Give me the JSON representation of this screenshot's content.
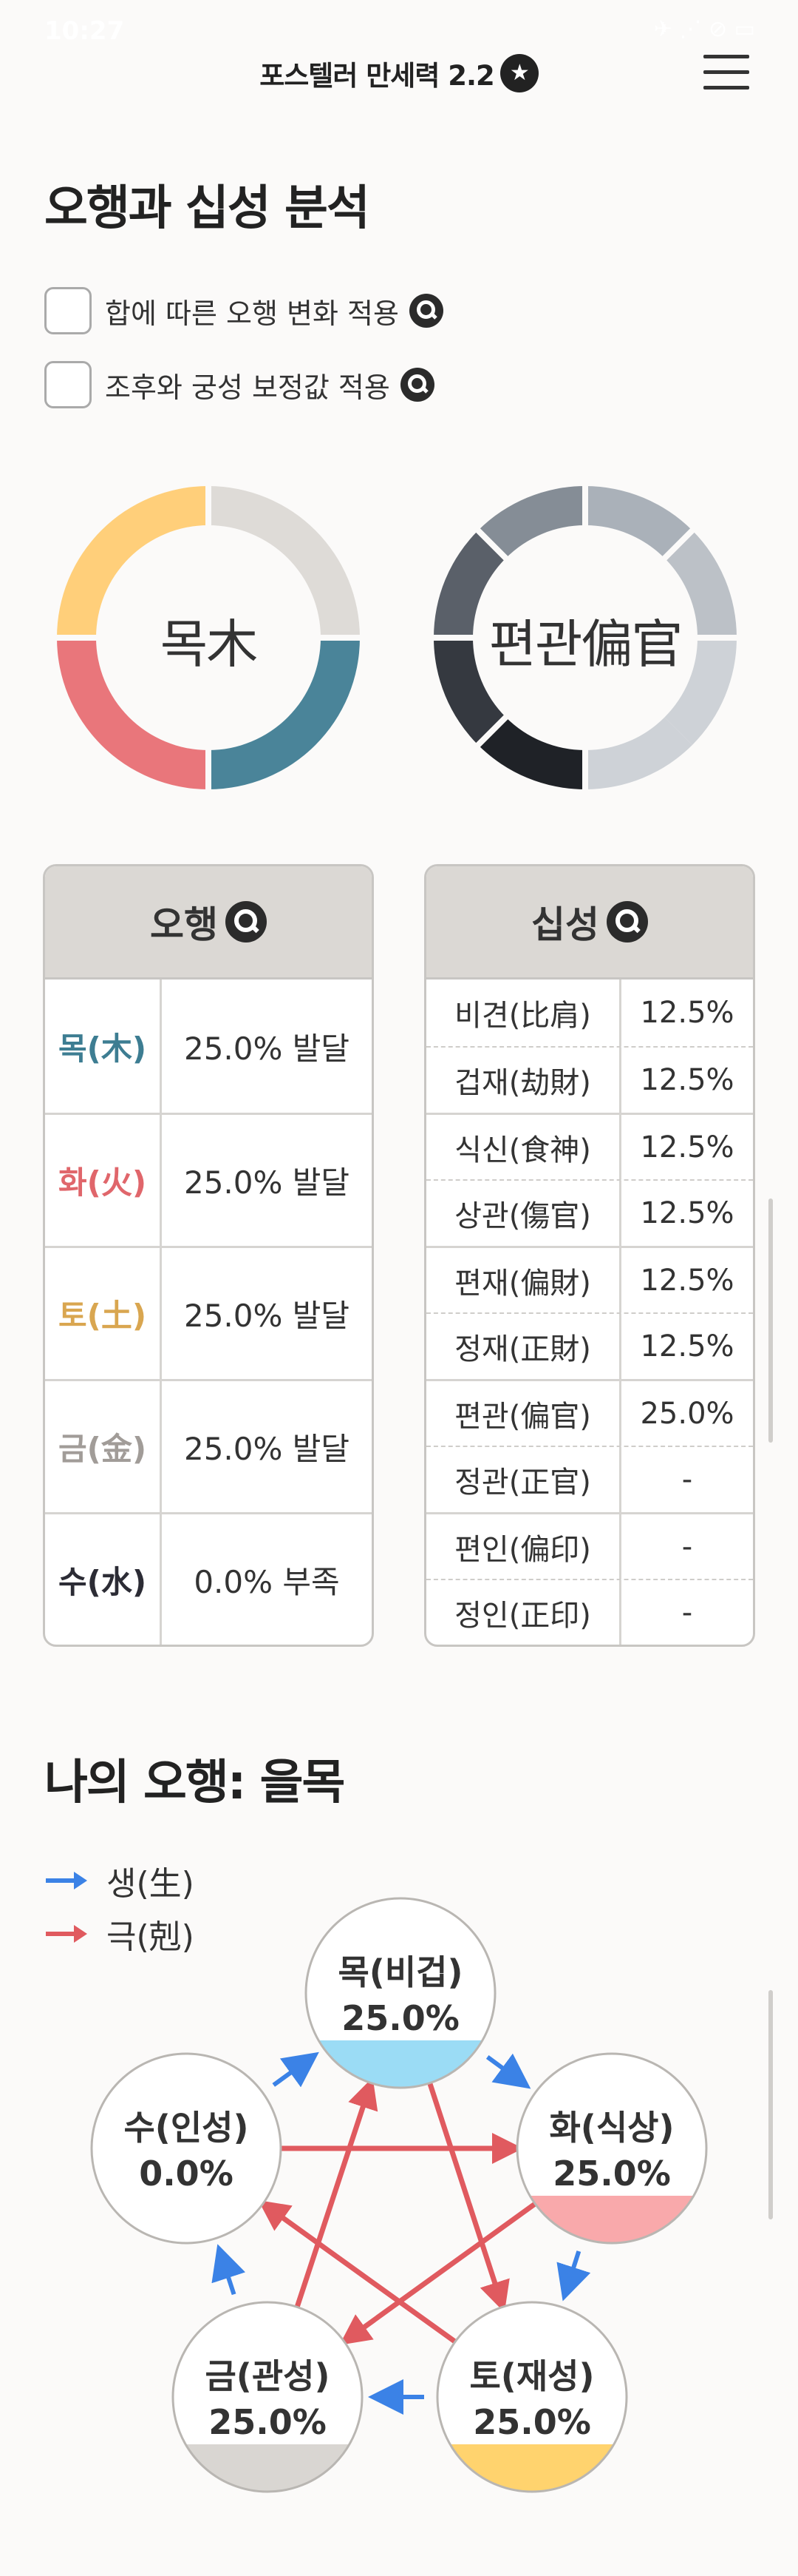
{
  "status": {
    "time": "10:27",
    "icons": "✈ ⋰ ⊘ ▭"
  },
  "header": {
    "title": "포스텔러 만세력 2.2",
    "star": "★"
  },
  "section1": {
    "heading": "오행과 십성 분석",
    "options": [
      {
        "label": "합에 따른 오행 변화 적용",
        "checked": false
      },
      {
        "label": "조후와 궁성 보정값 적용",
        "checked": false
      }
    ]
  },
  "donuts": {
    "ohaeng": {
      "label": "목木"
    },
    "sipseong": {
      "label": "편관偏官"
    }
  },
  "ohaeng_table": {
    "header": "오행",
    "rows": [
      {
        "element": "목(木)",
        "value": "25.0% 발달",
        "color": "#3d7d92"
      },
      {
        "element": "화(火)",
        "value": "25.0% 발달",
        "color": "#e0666b"
      },
      {
        "element": "토(土)",
        "value": "25.0% 발달",
        "color": "#d9a650"
      },
      {
        "element": "금(金)",
        "value": "25.0% 발달",
        "color": "#a19c98"
      },
      {
        "element": "수(水)",
        "value": "0.0% 부족",
        "color": "#2c2c35"
      }
    ]
  },
  "sipseong_table": {
    "header": "십성",
    "rows": [
      {
        "name": "비견(比肩)",
        "value": "12.5%"
      },
      {
        "name": "겁재(劫財)",
        "value": "12.5%"
      },
      {
        "name": "식신(食神)",
        "value": "12.5%"
      },
      {
        "name": "상관(傷官)",
        "value": "12.5%"
      },
      {
        "name": "편재(偏財)",
        "value": "12.5%"
      },
      {
        "name": "정재(正財)",
        "value": "12.5%"
      },
      {
        "name": "편관(偏官)",
        "value": "25.0%"
      },
      {
        "name": "정관(正官)",
        "value": "-"
      },
      {
        "name": "편인(偏印)",
        "value": "-"
      },
      {
        "name": "정인(正印)",
        "value": "-"
      }
    ]
  },
  "section2": {
    "heading": "나의 오행: 을목",
    "legend": [
      {
        "label": "생(生)",
        "color": "#3b82e6"
      },
      {
        "label": "극(剋)",
        "color": "#e05a5f"
      }
    ],
    "nodes": [
      {
        "name": "목(비겁)",
        "pct": "25.0%",
        "fill": 0.25,
        "fill_color": "#9bdcf5"
      },
      {
        "name": "화(식상)",
        "pct": "25.0%",
        "fill": 0.25,
        "fill_color": "#f9a9ab"
      },
      {
        "name": "토(재성)",
        "pct": "25.0%",
        "fill": 0.25,
        "fill_color": "#ffd36e"
      },
      {
        "name": "금(관성)",
        "pct": "25.0%",
        "fill": 0.25,
        "fill_color": "#d9d6d2"
      },
      {
        "name": "수(인성)",
        "pct": "0.0%",
        "fill": 0,
        "fill_color": "#cde"
      }
    ]
  }
}
